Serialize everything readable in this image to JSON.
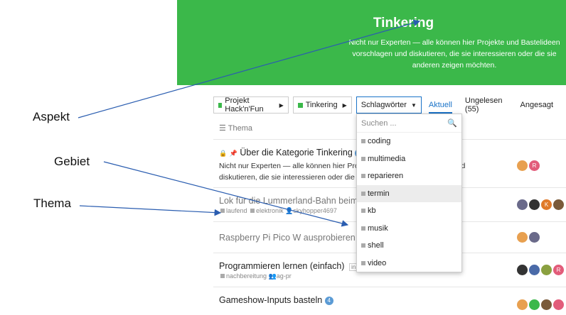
{
  "banner": {
    "title": "Tinkering",
    "description": "Nicht nur Experten — alle können hier Projekte und Bastelideen vorschlagen und diskutieren, die sie interessieren oder die sie anderen zeigen möchten.",
    "bg_color": "#3bb84a"
  },
  "annotations": {
    "aspekt": "Aspekt",
    "gebiet": "Gebiet",
    "thema": "Thema"
  },
  "nav": {
    "crumbs": [
      {
        "label": "Projekt Hack'n'Fun"
      },
      {
        "label": "Tinkering"
      }
    ],
    "tags_dropdown": "Schlagwörter",
    "links": [
      {
        "label": "Aktuell"
      },
      {
        "label": "Ungelesen (55)"
      },
      {
        "label": "Angesagt"
      }
    ]
  },
  "table": {
    "header": "Thema"
  },
  "dropdown": {
    "placeholder": "Suchen ...",
    "items": [
      "coding",
      "multimedia",
      "reparieren",
      "termin",
      "kb",
      "musik",
      "shell",
      "video"
    ]
  },
  "topics": [
    {
      "title": "Über die Kategorie Tinkering",
      "badge": "1",
      "excerpt": "Nicht nur Experten — alle können hier Projekte und Bastelideen vorschlagen und diskutieren, die sie interessieren oder die sie anderen zeigen möchten.",
      "excerpt_a": "Nicht nur Experten — alle können hier Projekte",
      "excerpt_a2": "und",
      "excerpt_b": "diskutieren, die sie interessieren oder die sie"
    },
    {
      "title": "Lok für die Lummerland-Bahn beim Lin",
      "tags": [
        "laufend",
        "elektronik"
      ],
      "user": "skyhopper4697"
    },
    {
      "title": "Raspberry Pi Pico W ausprobieren"
    },
    {
      "title": "Programmieren lernen (einfach)",
      "pill": "in 4 Ta",
      "tags": [
        "nachbereitung"
      ],
      "user": "ag-pr"
    },
    {
      "title": "Gameshow-Inputs basteln",
      "badge": "4"
    }
  ],
  "icons": {
    "search": "search-icon",
    "lock": "lock-icon",
    "pin": "pin-icon",
    "list": "list-icon"
  },
  "accent": "#1a73c8"
}
